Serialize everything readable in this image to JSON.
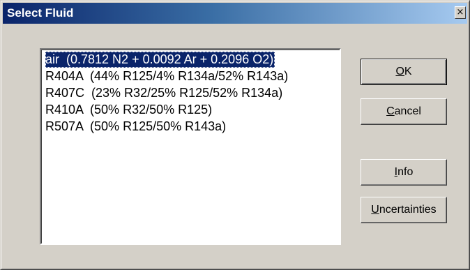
{
  "window": {
    "title": "Select Fluid",
    "close_glyph": "×"
  },
  "fluids": [
    "air  (0.7812 N2 + 0.0092 Ar + 0.2096 O2)",
    "R404A  (44% R125/4% R134a/52% R143a)",
    "R407C  (23% R32/25% R125/52% R134a)",
    "R410A  (50% R32/50% R125)",
    "R507A  (50% R125/50% R143a)"
  ],
  "selected_index": 0,
  "buttons": {
    "ok": {
      "accel": "O",
      "rest": "K"
    },
    "cancel": {
      "accel": "C",
      "rest": "ancel"
    },
    "info": {
      "accel": "I",
      "rest": "nfo"
    },
    "uncertainties": {
      "accel": "U",
      "rest": "ncertainties"
    }
  },
  "colors": {
    "selection": "#0a246a",
    "face": "#d4d0c8"
  }
}
